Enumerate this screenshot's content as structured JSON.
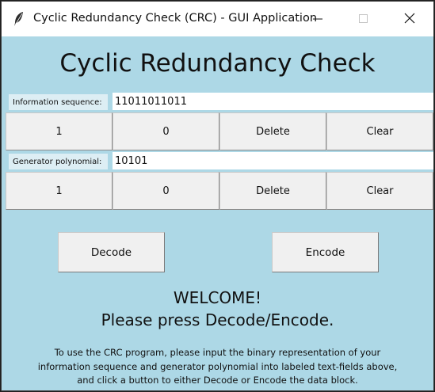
{
  "window": {
    "title": "Cyclic Redundancy Check (CRC) - GUI Application",
    "icons": {
      "app": "feather-icon",
      "minimize": "minimize-icon",
      "maximize": "maximize-icon",
      "close": "close-icon"
    }
  },
  "heading": "Cyclic Redundancy Check",
  "information": {
    "label": "Information sequence:",
    "value": "11011011011",
    "buttons": {
      "one": "1",
      "zero": "0",
      "delete": "Delete",
      "clear": "Clear"
    }
  },
  "generator": {
    "label": "Generator polynomial:",
    "value": "10101",
    "buttons": {
      "one": "1",
      "zero": "0",
      "delete": "Delete",
      "clear": "Clear"
    }
  },
  "actions": {
    "decode": "Decode",
    "encode": "Encode"
  },
  "status": {
    "line1": "WELCOME!",
    "line2": "Please press Decode/Encode."
  },
  "instructions": [
    "To use the CRC program, please input the binary representation of your",
    "information sequence and generator polynomial into labeled text-fields above,",
    "and click a button to either Decode or Encode the data block."
  ],
  "colors": {
    "background": "#add8e6",
    "button": "#f0f0f0",
    "label_bg": "#ddeef4"
  }
}
